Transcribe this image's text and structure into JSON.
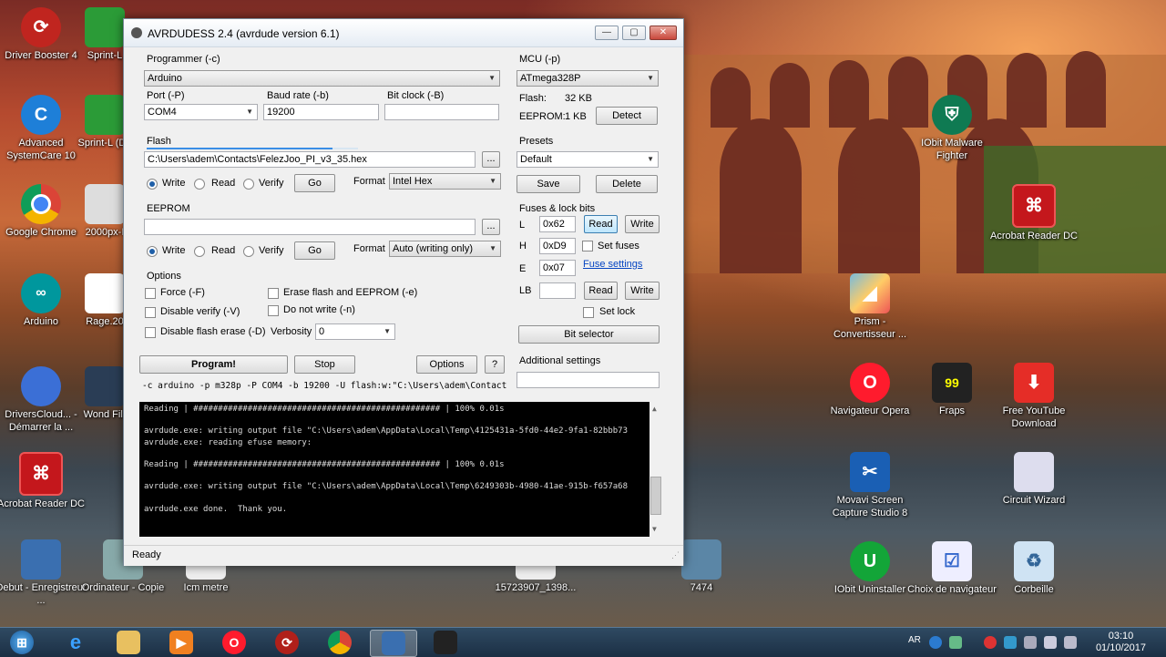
{
  "window": {
    "title": "AVRDUDESS 2.4 (avrdude version 6.1)",
    "min": "—",
    "max": "▢",
    "close": "✕"
  },
  "programmer": {
    "label": "Programmer (-c)",
    "value": "Arduino",
    "port_label": "Port (-P)",
    "port_value": "COM4",
    "baud_label": "Baud rate (-b)",
    "baud_value": "19200",
    "bitclock_label": "Bit clock (-B)",
    "bitclock_value": ""
  },
  "flash": {
    "label": "Flash",
    "file": "C:\\Users\\adem\\Contacts\\FelezJoo_PI_v3_35.hex",
    "browse": "...",
    "write": "Write",
    "read": "Read",
    "verify": "Verify",
    "go": "Go",
    "format_label": "Format",
    "format_value": "Intel Hex",
    "progress": 0.88
  },
  "eeprom": {
    "label": "EEPROM",
    "file": "",
    "browse": "...",
    "write": "Write",
    "read": "Read",
    "verify": "Verify",
    "go": "Go",
    "format_label": "Format",
    "format_value": "Auto (writing only)"
  },
  "options": {
    "label": "Options",
    "force": "Force (-F)",
    "disable_verify": "Disable verify (-V)",
    "disable_flash_erase": "Disable flash erase (-D)",
    "erase": "Erase flash and EEPROM (-e)",
    "no_write": "Do not write (-n)",
    "verbosity_label": "Verbosity",
    "verbosity_value": "0"
  },
  "actions": {
    "program": "Program!",
    "stop": "Stop",
    "options": "Options",
    "help": "?"
  },
  "command": "-c arduino -p m328p -P COM4 -b 19200 -U flash:w:\"C:\\Users\\adem\\Contacts",
  "mcu": {
    "label": "MCU (-p)",
    "value": "ATmega328P",
    "flash_label": "Flash:",
    "flash_value": "32 KB",
    "eeprom_label": "EEPROM:",
    "eeprom_value": "1 KB",
    "detect": "Detect"
  },
  "presets": {
    "label": "Presets",
    "value": "Default",
    "save": "Save",
    "delete": "Delete"
  },
  "fuses": {
    "label": "Fuses & lock bits",
    "L": "L",
    "L_value": "0x62",
    "H": "H",
    "H_value": "0xD9",
    "E": "E",
    "E_value": "0x07",
    "read": "Read",
    "write": "Write",
    "set_fuses": "Set fuses",
    "fuse_settings": "Fuse settings",
    "LB": "LB",
    "LB_value": "",
    "lb_read": "Read",
    "lb_write": "Write",
    "set_lock": "Set lock",
    "bit_selector": "Bit selector"
  },
  "additional": {
    "label": "Additional settings",
    "value": ""
  },
  "console_lines": [
    "Reading | ################################################## | 100% 0.01s",
    "",
    "avrdude.exe: writing output file \"C:\\Users\\adem\\AppData\\Local\\Temp\\4125431a-5fd0-44e2-9fa1-82bbb73",
    "avrdude.exe: reading efuse memory:",
    "",
    "Reading | ################################################## | 100% 0.01s",
    "",
    "avrdude.exe: writing output file \"C:\\Users\\adem\\AppData\\Local\\Temp\\6249303b-4980-41ae-915b-f657a68",
    "",
    "avrdude.exe done.  Thank you.",
    ""
  ],
  "status": "Ready",
  "desktop_icons": {
    "driver_booster": "Driver Booster 4",
    "sprint1": "Sprint-L",
    "advanced_systemcare": "Advanced SystemCare 10",
    "sprint2": "Sprint-L (De",
    "chrome": "Google Chrome",
    "px2000": "2000px-I",
    "arduino": "Arduino",
    "rage": "Rage.20",
    "drivers_cloud": "DriversCloud... - Démarrer la ...",
    "wondershare": "Wond Filr",
    "acrobat_left": "Acrobat Reader DC",
    "debut": "Debut - Enregistreur ...",
    "ordinateur": "Ordinateur - Copie",
    "icm": "Icm metre",
    "img15723907": "15723907_1398...",
    "n7474": "7474",
    "iobit_malware": "IObit Malware Fighter",
    "acrobat_right": "Acrobat Reader DC",
    "prism": "Prism - Convertisseur ...",
    "opera": "Navigateur Opera",
    "fraps": "Fraps",
    "youtube": "Free YouTube Download",
    "movavi": "Movavi Screen Capture Studio 8",
    "circuit_wizard": "Circuit Wizard",
    "iobit_uninstaller": "IObit Uninstaller",
    "choix": "Choix de navigateur",
    "corbeille": "Corbeille",
    "fraps_badge": "99"
  },
  "taskbar": {
    "lang": "AR",
    "time": "03:10",
    "date": "01/10/2017"
  }
}
